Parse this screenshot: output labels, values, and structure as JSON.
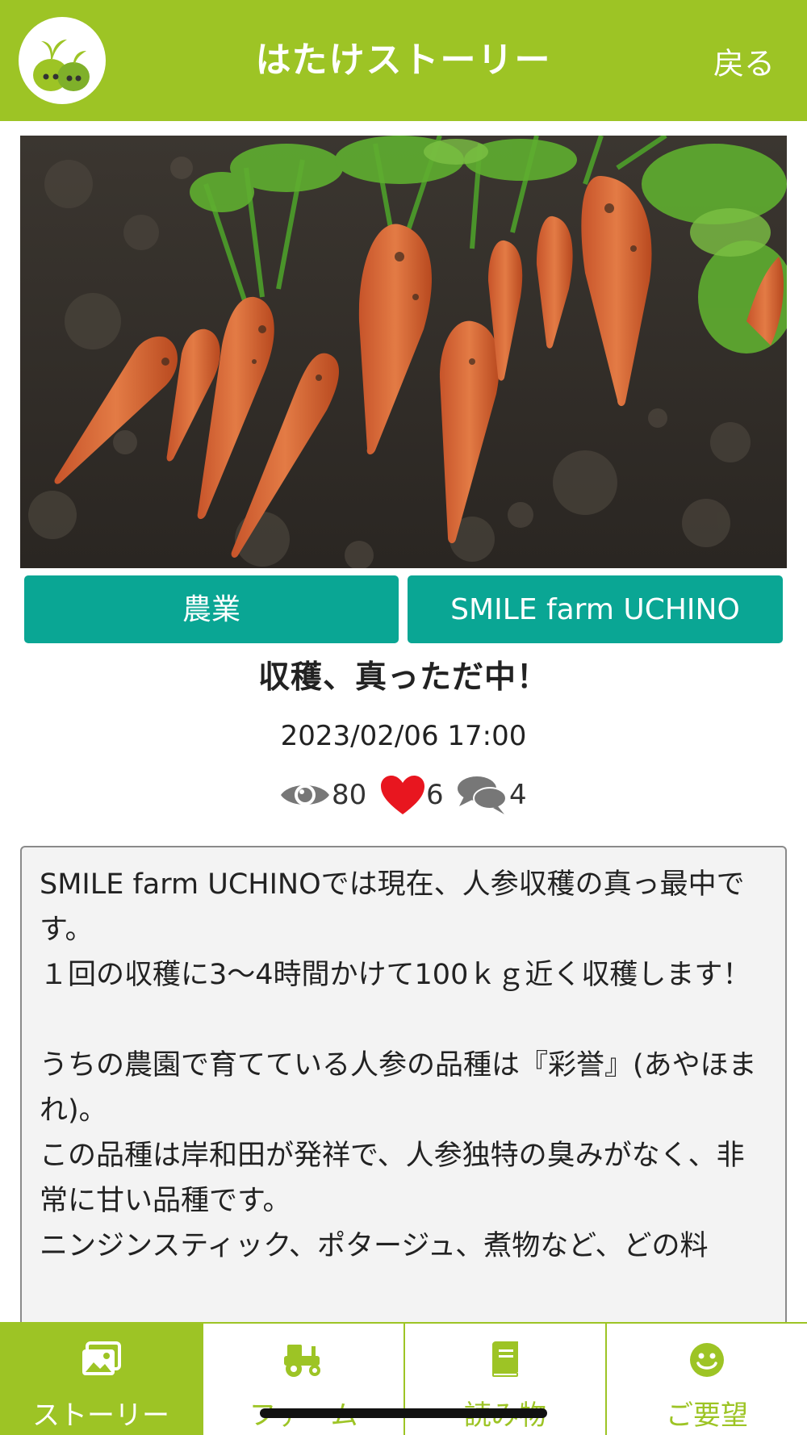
{
  "header": {
    "title": "はたけストーリー",
    "back_label": "戻る"
  },
  "post": {
    "tags": [
      "農業",
      "SMILE farm UCHINO"
    ],
    "title": "収穫、真っただ中！",
    "date": "2023/02/06 17:00",
    "views": "80",
    "likes": "6",
    "comments": "4",
    "body": "SMILE farm UCHINOでは現在、人参収穫の真っ最中です。\n１回の収穫に3〜4時間かけて100ｋｇ近く収穫します！\n\nうちの農園で育てている人参の品種は『彩誉』(あやほまれ)。\nこの品種は岸和田が発祥で、人参独特の臭みがなく、非常に甘い品種です。\nニンジンスティック、ポタージュ、煮物など、どの料"
  },
  "nav": {
    "items": [
      {
        "label": "ストーリー",
        "icon": "photos-icon"
      },
      {
        "label": "ファーム",
        "icon": "tractor-icon"
      },
      {
        "label": "読み物",
        "icon": "book-icon"
      },
      {
        "label": "ご要望",
        "icon": "smile-icon"
      }
    ]
  },
  "colors": {
    "brand_green": "#9dc425",
    "tag_teal": "#0aa694",
    "heart_red": "#e8161f"
  }
}
